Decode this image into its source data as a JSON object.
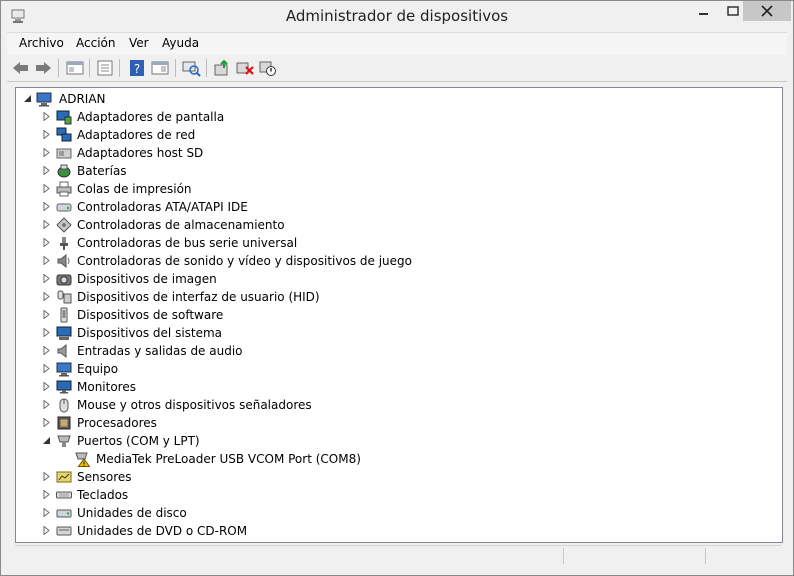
{
  "window": {
    "title": "Administrador de dispositivos"
  },
  "menu": [
    "Archivo",
    "Acción",
    "Ver",
    "Ayuda"
  ],
  "toolbar": [
    "back-icon",
    "forward-icon",
    "up-level-icon",
    "show-hide-tree-icon",
    "properties-icon",
    "help-icon",
    "action-pane-icon",
    "scan-hardware-icon",
    "update-driver-icon",
    "uninstall-device-icon",
    "disable-device-icon"
  ],
  "tree": {
    "root": "ADRIAN",
    "items": [
      {
        "label": "Adaptadores de pantalla",
        "icon": "display-adapter-icon",
        "expanded": false
      },
      {
        "label": "Adaptadores de red",
        "icon": "network-adapter-icon",
        "expanded": false
      },
      {
        "label": "Adaptadores host SD",
        "icon": "sd-host-icon",
        "expanded": false
      },
      {
        "label": "Baterías",
        "icon": "battery-icon",
        "expanded": false
      },
      {
        "label": "Colas de impresión",
        "icon": "printer-icon",
        "expanded": false
      },
      {
        "label": "Controladoras ATA/ATAPI IDE",
        "icon": "ide-controller-icon",
        "expanded": false
      },
      {
        "label": "Controladoras de almacenamiento",
        "icon": "storage-controller-icon",
        "expanded": false
      },
      {
        "label": "Controladoras de bus serie universal",
        "icon": "usb-controller-icon",
        "expanded": false
      },
      {
        "label": "Controladoras de sonido y vídeo y dispositivos de juego",
        "icon": "sound-icon",
        "expanded": false
      },
      {
        "label": "Dispositivos de imagen",
        "icon": "camera-icon",
        "expanded": false
      },
      {
        "label": "Dispositivos de interfaz de usuario (HID)",
        "icon": "hid-icon",
        "expanded": false
      },
      {
        "label": "Dispositivos de software",
        "icon": "software-device-icon",
        "expanded": false
      },
      {
        "label": "Dispositivos del sistema",
        "icon": "system-device-icon",
        "expanded": false
      },
      {
        "label": "Entradas y salidas de audio",
        "icon": "audio-io-icon",
        "expanded": false
      },
      {
        "label": "Equipo",
        "icon": "computer-icon",
        "expanded": false
      },
      {
        "label": "Monitores",
        "icon": "monitor-icon",
        "expanded": false
      },
      {
        "label": "Mouse y otros dispositivos señaladores",
        "icon": "mouse-icon",
        "expanded": false
      },
      {
        "label": "Procesadores",
        "icon": "processor-icon",
        "expanded": false
      },
      {
        "label": "Puertos (COM y LPT)",
        "icon": "port-icon",
        "expanded": true,
        "children": [
          {
            "label": "MediaTek PreLoader USB VCOM Port (COM8)",
            "icon": "warning-port-icon"
          }
        ]
      },
      {
        "label": "Sensores",
        "icon": "sensor-icon",
        "expanded": false
      },
      {
        "label": "Teclados",
        "icon": "keyboard-icon",
        "expanded": false
      },
      {
        "label": "Unidades de disco",
        "icon": "disk-drive-icon",
        "expanded": false
      },
      {
        "label": "Unidades de DVD o CD-ROM",
        "icon": "dvd-drive-icon",
        "expanded": false
      }
    ]
  },
  "colors": {
    "warning": "#f2c200",
    "window_bg": "#f0f0f0"
  }
}
